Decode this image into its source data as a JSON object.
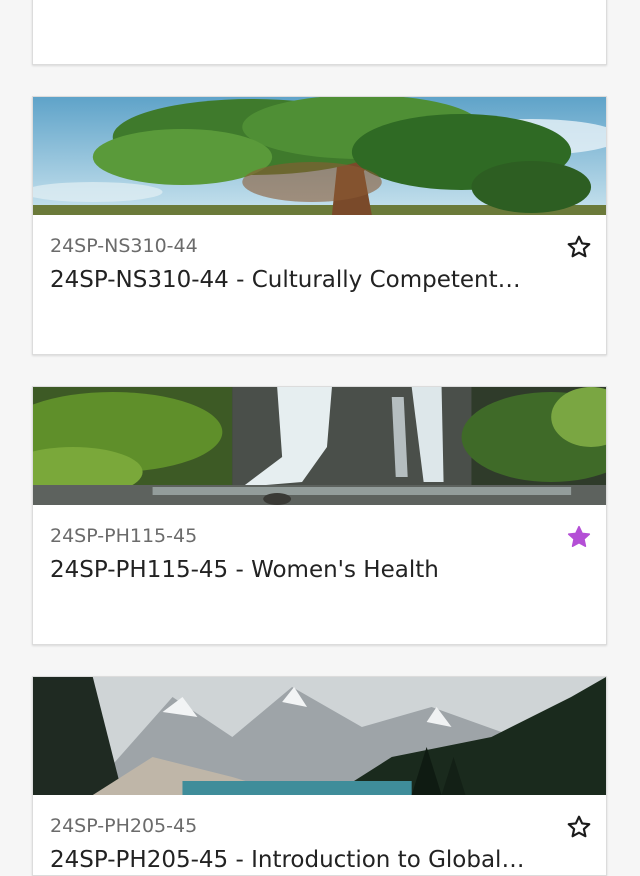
{
  "colors": {
    "favorite_active": "#b44fd6",
    "favorite_inactive": "#1b1b1b",
    "page_background": "#f6f6f6"
  },
  "courses": [
    {
      "code": "",
      "title": "",
      "favorite": false,
      "banner_image": "partial-card"
    },
    {
      "code": "24SP-NS310-44",
      "title": "24SP-NS310-44 - Culturally Competent…",
      "favorite": false,
      "banner_image": "tree-landscape"
    },
    {
      "code": "24SP-PH115-45",
      "title": "24SP-PH115-45 - Women's Health",
      "favorite": true,
      "banner_image": "waterfall-forest"
    },
    {
      "code": "24SP-PH205-45",
      "title": "24SP-PH205-45 - Introduction to Global…",
      "favorite": false,
      "banner_image": "mountain-lake"
    }
  ]
}
